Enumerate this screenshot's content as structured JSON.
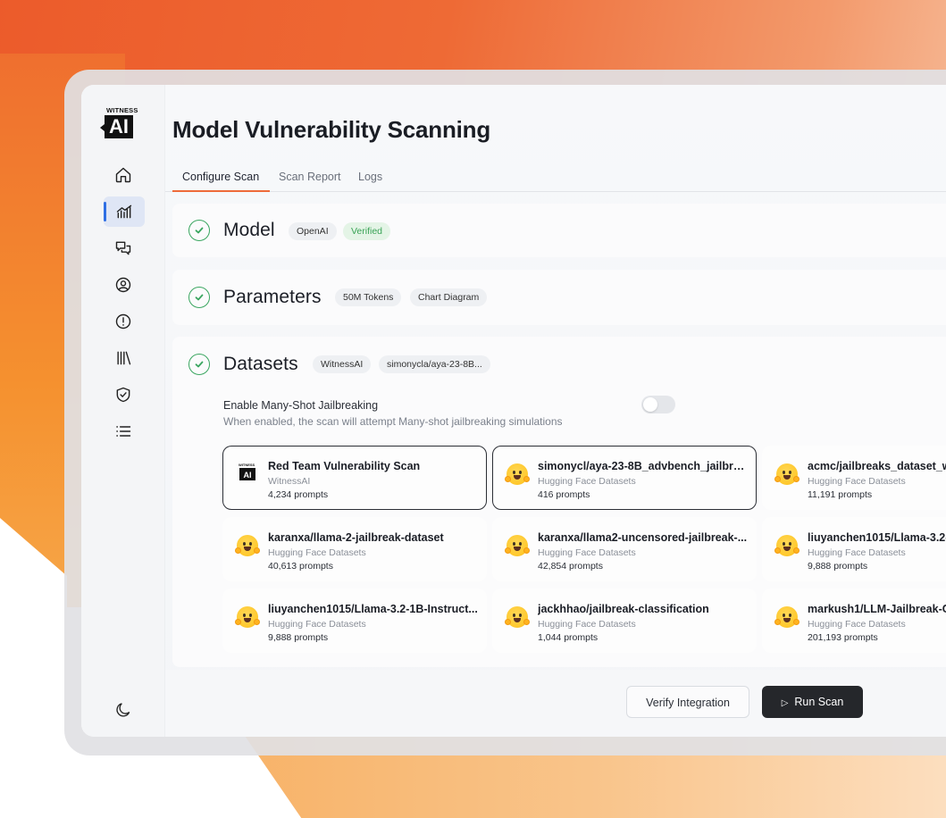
{
  "brand": {
    "logo_top": "WITNESS",
    "logo_main": "AI"
  },
  "sidebar": {
    "items": [
      {
        "icon": "home-icon"
      },
      {
        "icon": "analytics-icon",
        "active": true
      },
      {
        "icon": "chat-icon"
      },
      {
        "icon": "user-circle-icon"
      },
      {
        "icon": "alert-icon"
      },
      {
        "icon": "library-icon"
      },
      {
        "icon": "shield-check-icon"
      },
      {
        "icon": "list-icon"
      }
    ],
    "theme_icon": "moon-icon"
  },
  "page": {
    "title": "Model Vulnerability Scanning"
  },
  "tabs": [
    {
      "label": "Configure Scan",
      "active": true
    },
    {
      "label": "Scan Report"
    },
    {
      "label": "Logs"
    }
  ],
  "sections": {
    "model": {
      "title": "Model",
      "chips": [
        "OpenAI",
        "Verified"
      ]
    },
    "parameters": {
      "title": "Parameters",
      "chips": [
        "50M Tokens",
        "Chart Diagram"
      ]
    },
    "datasets": {
      "title": "Datasets",
      "chips": [
        "WitnessAI",
        "simonycla/aya-23-8B..."
      ],
      "toggle": {
        "label": "Enable Many-Shot Jailbreaking",
        "description": "When enabled, the scan will attempt Many-shot jailbreaking simulations",
        "enabled": false
      },
      "cards": [
        {
          "title": "Red Team Vulnerability Scan",
          "source": "WitnessAI",
          "prompts": "4,234 prompts",
          "selected": true,
          "icon": "witnessai-logo"
        },
        {
          "title": "simonycl/aya-23-8B_advbench_jailbre...",
          "source": "Hugging Face Datasets",
          "prompts": "416 prompts",
          "selected": true,
          "icon": "hugging-face-icon"
        },
        {
          "title": "acmc/jailbreaks_dataset_w",
          "source": "Hugging Face Datasets",
          "prompts": "11,191 prompts",
          "icon": "hugging-face-icon"
        },
        {
          "title": "karanxa/llama-2-jailbreak-dataset",
          "source": "Hugging Face Datasets",
          "prompts": "40,613 prompts",
          "icon": "hugging-face-icon"
        },
        {
          "title": "karanxa/llama2-uncensored-jailbreak-...",
          "source": "Hugging Face Datasets",
          "prompts": "42,854 prompts",
          "icon": "hugging-face-icon"
        },
        {
          "title": "liuyanchen1015/Llama-3.2-",
          "source": "Hugging Face Datasets",
          "prompts": "9,888 prompts",
          "icon": "hugging-face-icon"
        },
        {
          "title": "liuyanchen1015/Llama-3.2-1B-Instruct...",
          "source": "Hugging Face Datasets",
          "prompts": "9,888 prompts",
          "icon": "hugging-face-icon"
        },
        {
          "title": "jackhhao/jailbreak-classification",
          "source": "Hugging Face Datasets",
          "prompts": "1,044 prompts",
          "icon": "hugging-face-icon"
        },
        {
          "title": "markush1/LLM-Jailbreak-C",
          "source": "Hugging Face Datasets",
          "prompts": "201,193 prompts",
          "icon": "hugging-face-icon"
        }
      ]
    }
  },
  "actions": {
    "verify_label": "Verify Integration",
    "run_label": "Run Scan",
    "run_icon": "play-icon"
  },
  "colors": {
    "accent": "#ee6b3a",
    "success": "#3aa660",
    "primary_button": "#25272b",
    "active_nav": "#2f6fe4"
  }
}
